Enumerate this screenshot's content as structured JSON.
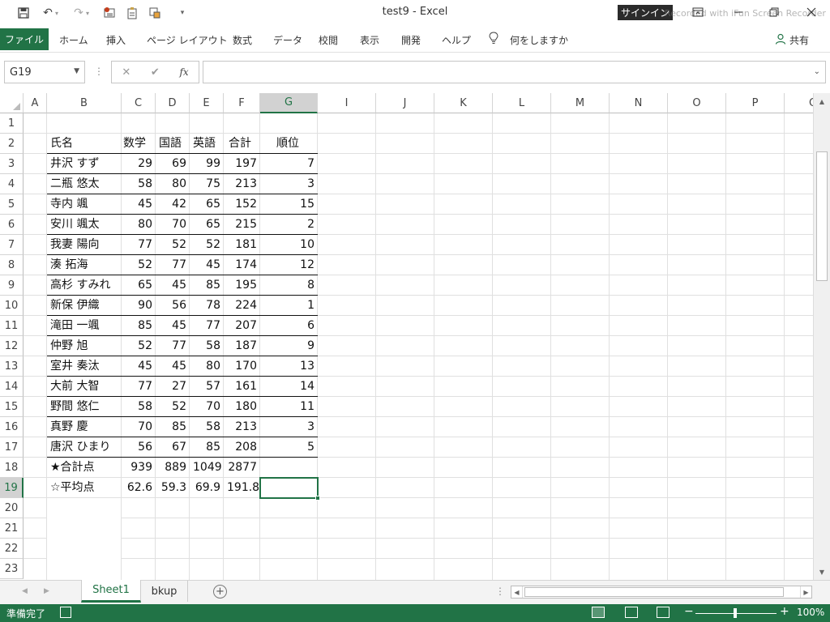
{
  "titlebar": {
    "doc_title": "test9  -  Excel",
    "signin_label": "サインイン",
    "watermark": "Recorded with iFun Screen Recorder"
  },
  "ribbon": {
    "file_tab": "ファイル",
    "tabs": [
      "ホーム",
      "挿入",
      "ページ レイアウト",
      "数式",
      "データ",
      "校閲",
      "表示",
      "開発",
      "ヘルプ"
    ],
    "tell_me": "何をしますか",
    "share": "共有"
  },
  "formula_bar": {
    "name_box": "G19",
    "fx_label": "fx",
    "formula": ""
  },
  "grid": {
    "columns": [
      "A",
      "B",
      "C",
      "D",
      "E",
      "F",
      "G",
      "I",
      "J",
      "K",
      "L",
      "M",
      "N",
      "O",
      "P",
      "Q"
    ],
    "active_column": "G",
    "rows": [
      "1",
      "2",
      "3",
      "4",
      "5",
      "6",
      "7",
      "8",
      "9",
      "10",
      "11",
      "12",
      "13",
      "14",
      "15",
      "16",
      "17",
      "18",
      "19",
      "20",
      "21",
      "22",
      "23"
    ],
    "active_row": "19"
  },
  "table": {
    "headers": {
      "name": "氏名",
      "math": "数学",
      "japanese": "国語",
      "english": "英語",
      "total": "合計",
      "rank": "順位"
    },
    "records": [
      {
        "name": "井沢 すず",
        "math": "29",
        "japanese": "69",
        "english": "99",
        "total": "197",
        "rank": "7"
      },
      {
        "name": "二瓶 悠太",
        "math": "58",
        "japanese": "80",
        "english": "75",
        "total": "213",
        "rank": "3"
      },
      {
        "name": "寺内 颯",
        "math": "45",
        "japanese": "42",
        "english": "65",
        "total": "152",
        "rank": "15"
      },
      {
        "name": "安川 颯太",
        "math": "80",
        "japanese": "70",
        "english": "65",
        "total": "215",
        "rank": "2"
      },
      {
        "name": "我妻 陽向",
        "math": "77",
        "japanese": "52",
        "english": "52",
        "total": "181",
        "rank": "10"
      },
      {
        "name": "湊 拓海",
        "math": "52",
        "japanese": "77",
        "english": "45",
        "total": "174",
        "rank": "12"
      },
      {
        "name": "高杉 すみれ",
        "math": "65",
        "japanese": "45",
        "english": "85",
        "total": "195",
        "rank": "8"
      },
      {
        "name": "新保 伊織",
        "math": "90",
        "japanese": "56",
        "english": "78",
        "total": "224",
        "rank": "1"
      },
      {
        "name": "滝田 一颯",
        "math": "85",
        "japanese": "45",
        "english": "77",
        "total": "207",
        "rank": "6"
      },
      {
        "name": "仲野 旭",
        "math": "52",
        "japanese": "77",
        "english": "58",
        "total": "187",
        "rank": "9"
      },
      {
        "name": "室井 奏汰",
        "math": "45",
        "japanese": "45",
        "english": "80",
        "total": "170",
        "rank": "13"
      },
      {
        "name": "大前 大智",
        "math": "77",
        "japanese": "27",
        "english": "57",
        "total": "161",
        "rank": "14"
      },
      {
        "name": "野間 悠仁",
        "math": "58",
        "japanese": "52",
        "english": "70",
        "total": "180",
        "rank": "11"
      },
      {
        "name": "真野 慶",
        "math": "70",
        "japanese": "85",
        "english": "58",
        "total": "213",
        "rank": "3"
      },
      {
        "name": "唐沢 ひまり",
        "math": "56",
        "japanese": "67",
        "english": "85",
        "total": "208",
        "rank": "5"
      }
    ],
    "summary": [
      {
        "name": "★合計点",
        "math": "939",
        "japanese": "889",
        "english": "1049",
        "total": "2877",
        "rank": ""
      },
      {
        "name": "☆平均点",
        "math": "62.6",
        "japanese": "59.3",
        "english": "69.9",
        "total": "191.8",
        "rank": ""
      }
    ]
  },
  "sheet_tabs": {
    "tabs": [
      "Sheet1",
      "bkup"
    ],
    "active": "Sheet1"
  },
  "status_bar": {
    "status": "準備完了",
    "zoom": "100%"
  },
  "icons": {
    "save": "save-icon",
    "undo": "undo-icon",
    "redo": "redo-icon",
    "lightbulb": "lightbulb-icon",
    "person": "person-icon"
  },
  "colors": {
    "accent": "#217346"
  }
}
